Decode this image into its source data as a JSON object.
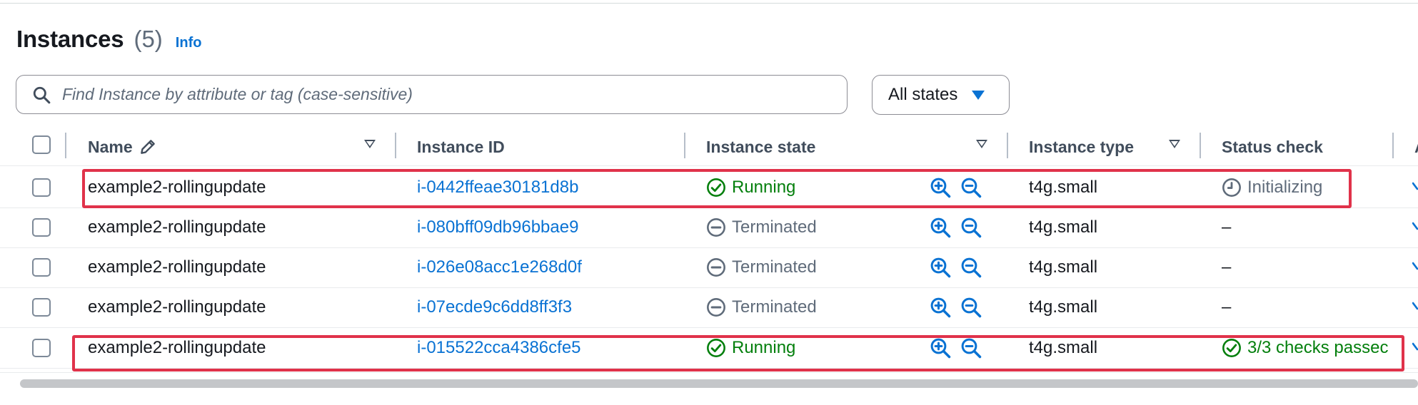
{
  "header": {
    "title": "Instances",
    "count": "(5)",
    "info_link": "Info"
  },
  "search": {
    "placeholder": "Find Instance by attribute or tag (case-sensitive)",
    "value": ""
  },
  "state_filter": {
    "selected": "All states"
  },
  "columns": {
    "name": "Name",
    "instance_id": "Instance ID",
    "instance_state": "Instance state",
    "instance_type": "Instance type",
    "status_check": "Status check",
    "next_col_partial": "A"
  },
  "rows": [
    {
      "name": "example2-rollingupdate",
      "instance_id": "i-0442ffeae30181d8b",
      "state": "Running",
      "state_kind": "running",
      "type": "t4g.small",
      "status": "Initializing",
      "status_kind": "initializing"
    },
    {
      "name": "example2-rollingupdate",
      "instance_id": "i-080bff09db96bbae9",
      "state": "Terminated",
      "state_kind": "terminated",
      "type": "t4g.small",
      "status": "–",
      "status_kind": "none"
    },
    {
      "name": "example2-rollingupdate",
      "instance_id": "i-026e08acc1e268d0f",
      "state": "Terminated",
      "state_kind": "terminated",
      "type": "t4g.small",
      "status": "–",
      "status_kind": "none"
    },
    {
      "name": "example2-rollingupdate",
      "instance_id": "i-07ecde9c6dd8ff3f3",
      "state": "Terminated",
      "state_kind": "terminated",
      "type": "t4g.small",
      "status": "–",
      "status_kind": "none"
    },
    {
      "name": "example2-rollingupdate",
      "instance_id": "i-015522cca4386cfe5",
      "state": "Running",
      "state_kind": "running",
      "type": "t4g.small",
      "status": "3/3 checks passec",
      "status_kind": "passed"
    }
  ],
  "highlighted_rows": [
    0,
    4
  ],
  "colors": {
    "link": "#0972d3",
    "running": "#037f0c",
    "terminated": "#5f6b7a",
    "highlight": "#e0324a"
  },
  "icons": {
    "search": "search-icon",
    "edit": "pencil-icon",
    "running": "check-circle-icon",
    "terminated": "minus-circle-icon",
    "initializing": "clock-icon",
    "zoom_in": "zoom-in-icon",
    "zoom_out": "zoom-out-icon"
  }
}
